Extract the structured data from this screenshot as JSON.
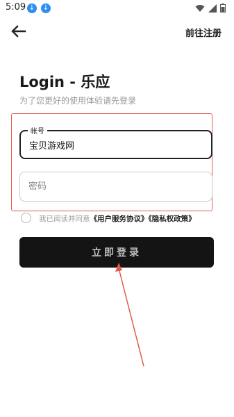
{
  "status_bar": {
    "time": "5:09",
    "notification_icons": [
      "download-icon",
      "download-icon"
    ],
    "system_icons": [
      "wifi-icon",
      "signal-icon",
      "battery-icon"
    ]
  },
  "header": {
    "back_icon": "arrow-left-icon",
    "register_label": "前往注册"
  },
  "login": {
    "title": "Login - 乐应",
    "subtitle": "为了您更好的使用体验请先登录",
    "account_field": {
      "label": "帐号",
      "value": "宝贝游戏网"
    },
    "password_field": {
      "placeholder": "密码",
      "value": ""
    },
    "agreement": {
      "prefix": "我已阅读并同意",
      "user_agreement": "《用户服务协议》",
      "privacy_policy": "《隐私权政策》"
    },
    "submit_label": "立即登录"
  },
  "colors": {
    "button_bg": "#141414",
    "annotation_red": "#e05a4a",
    "accent_blue": "#2f8ff0"
  }
}
